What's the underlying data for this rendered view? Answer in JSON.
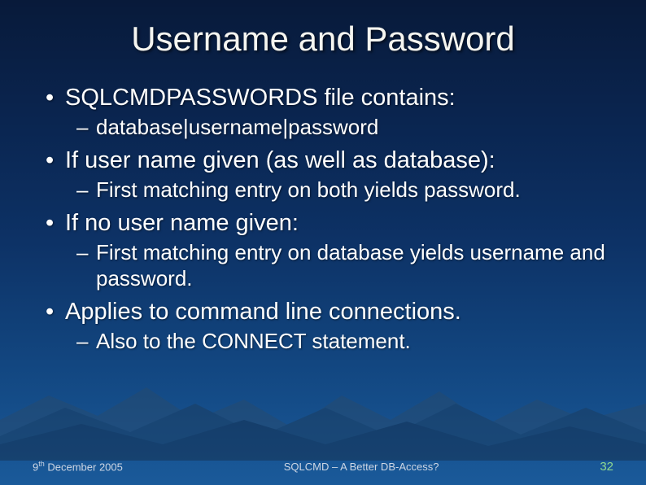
{
  "title": "Username and Password",
  "bullets": [
    {
      "text": "SQLCMDPASSWORDS file contains:",
      "sub": [
        {
          "text": "database|username|password"
        }
      ]
    },
    {
      "text": "If user name given (as well as database):",
      "sub": [
        {
          "text": "First matching entry on both yields password."
        }
      ]
    },
    {
      "text": "If no user name given:",
      "sub": [
        {
          "text": "First matching entry on database yields username and password."
        }
      ]
    },
    {
      "text": "Applies to command line connections.",
      "sub": [
        {
          "text": "Also to the CONNECT statement."
        }
      ]
    }
  ],
  "footer": {
    "date_day": "9",
    "date_ord": "th",
    "date_rest": " December 2005",
    "center": "SQLCMD – A Better DB-Access?",
    "page": "32"
  }
}
